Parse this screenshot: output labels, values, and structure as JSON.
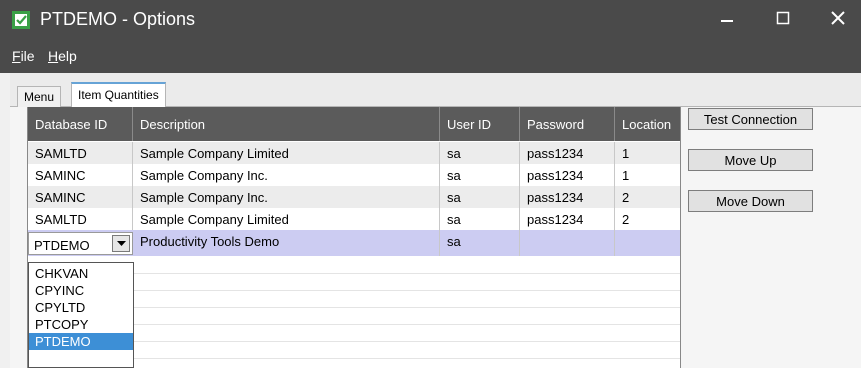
{
  "window": {
    "title": "PTDEMO - Options",
    "minimize_glyph": "—",
    "maximize_glyph": "☐",
    "close_glyph": "✕",
    "icon": "app-icon"
  },
  "menu": {
    "file_ul": "F",
    "file_rest": "ile",
    "help_ul": "H",
    "help_rest": "elp"
  },
  "tabs": [
    {
      "label": "Menu"
    },
    {
      "label": "Item Quantities"
    }
  ],
  "grid": {
    "columns": [
      "Database ID",
      "Description",
      "User ID",
      "Password",
      "Location"
    ],
    "rows": [
      [
        "SAMLTD",
        "Sample Company Limited",
        "sa",
        "pass1234",
        "1"
      ],
      [
        "SAMINC",
        "Sample Company Inc.",
        "sa",
        "pass1234",
        "1"
      ],
      [
        "SAMINC",
        "Sample Company Inc.",
        "sa",
        "pass1234",
        "2"
      ],
      [
        "SAMLTD",
        "Sample Company Limited",
        "sa",
        "pass1234",
        "2"
      ]
    ],
    "edit_row": {
      "database_id": "PTDEMO",
      "description": "Productivity Tools Demo",
      "user_id": "sa",
      "password": "",
      "location": ""
    },
    "dropdown_options": [
      "CHKVAN",
      "CPYINC",
      "CPYLTD",
      "PTCOPY",
      "PTDEMO"
    ],
    "dropdown_selected": "PTDEMO"
  },
  "buttons": {
    "test_connection": "Test Connection",
    "move_up": "Move Up",
    "move_down": "Move Down"
  },
  "colors": {
    "titlebar": "#4a4a4a",
    "header": "#5b5b5b",
    "selected_row": "#ccccf2",
    "highlight": "#3d8fd6",
    "icon_green": "#3aa046"
  }
}
